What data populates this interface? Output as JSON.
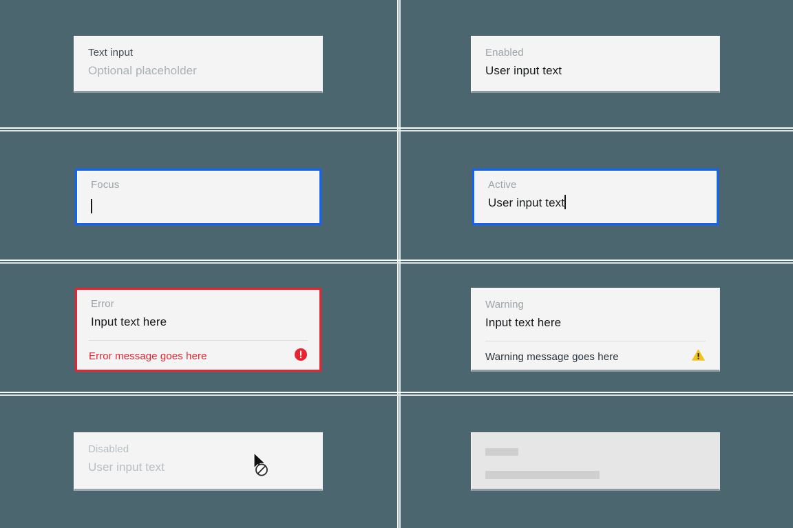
{
  "meta": {
    "background_color": "#4c6670",
    "field_background": "#f4f4f4",
    "focus_border_color": "#0f62fe",
    "error_color": "#e8232f",
    "warning_color": "#f1c21b",
    "skeleton_background": "#e6e6e6",
    "skeleton_bar_color": "#cfcfcf"
  },
  "cells": {
    "default": {
      "state": "Default",
      "label": "Text input",
      "placeholder": "Optional placeholder"
    },
    "enabled": {
      "state": "Enabled",
      "label": "Enabled",
      "value": "User input text"
    },
    "focus": {
      "state": "Focus",
      "label": "Focus",
      "value": ""
    },
    "active": {
      "state": "Active",
      "label": "Active",
      "value": "User input text"
    },
    "error": {
      "state": "Error",
      "label": "Error",
      "value": "Input text here",
      "message": "Error message goes here",
      "icon": "error-filled-icon"
    },
    "warning": {
      "state": "Warning",
      "label": "Warning",
      "value": "Input text here",
      "message": "Warning message goes here",
      "icon": "warning-triangle-icon"
    },
    "disabled": {
      "state": "Disabled",
      "label": "Disabled",
      "value": "User input text",
      "cursor_icon": "not-allowed-cursor-icon"
    },
    "skeleton": {
      "state": "Skeleton",
      "label": "",
      "value": ""
    }
  }
}
